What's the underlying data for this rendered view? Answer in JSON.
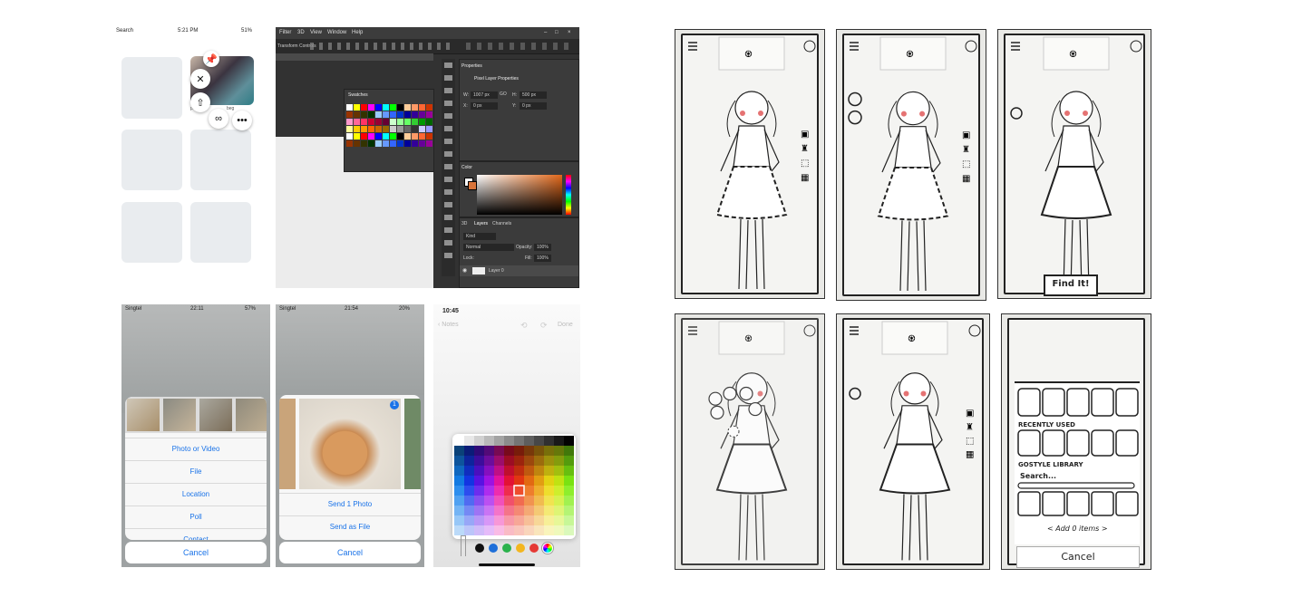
{
  "p1": {
    "status_left": "Search",
    "status_time": "5:21 PM",
    "status_battery": "51%",
    "pin_snippet": "pi",
    "pin_snippet2": "beg"
  },
  "p2": {
    "menu": [
      "Filter",
      "3D",
      "View",
      "Window",
      "Help"
    ],
    "option": "Transform Controls",
    "properties_tab": "Properties",
    "pixel_layer": "Pixel Layer Properties",
    "w_label": "W:",
    "w_value": "1007 px",
    "h_label": "H:",
    "h_value": "500 px",
    "go_label": "GO",
    "x_label": "X:",
    "x_value": "0 px",
    "y_label": "Y:",
    "y_value": "0 px",
    "swatches_tab": "Swatches",
    "color_tab": "Color",
    "layers_tabs": [
      "3D",
      "Layers",
      "Channels"
    ],
    "kind": "Kind",
    "blend": "Normal",
    "opacity_label": "Opacity:",
    "opacity_value": "100%",
    "lock_label": "Lock:",
    "fill_label": "Fill:",
    "fill_value": "100%",
    "layer_name": "Layer 0",
    "swatch_colors": [
      "#ffffff",
      "#ffff00",
      "#ff0000",
      "#ff00ff",
      "#0000ff",
      "#00ffff",
      "#00ff00",
      "#000000",
      "#ffcc99",
      "#ff9966",
      "#ff6633",
      "#cc3300",
      "#993300",
      "#663300",
      "#333300",
      "#003300",
      "#99ccff",
      "#6699ff",
      "#3366ff",
      "#0033cc",
      "#000099",
      "#330099",
      "#660099",
      "#990099",
      "#ff99cc",
      "#ff6699",
      "#ff3366",
      "#cc0033",
      "#990033",
      "#660033",
      "#ccffcc",
      "#99ff99",
      "#66ff66",
      "#33cc33",
      "#009900",
      "#006600",
      "#ffff99",
      "#ffcc00",
      "#ff9900",
      "#ff6600",
      "#cc6600",
      "#996600",
      "#cccccc",
      "#999999",
      "#666666",
      "#333333",
      "#ccccff",
      "#9999ff"
    ]
  },
  "p3": {
    "carrier": "Singtel",
    "time": "22:11",
    "battery": "57%",
    "options": [
      "Photo or Video",
      "File",
      "Location",
      "Poll",
      "Contact"
    ],
    "cancel": "Cancel"
  },
  "p4": {
    "carrier": "Singtel",
    "time": "21:54",
    "battery": "20%",
    "badge": "1",
    "options": [
      "Send 1 Photo",
      "Send as File"
    ],
    "cancel": "Cancel"
  },
  "p5": {
    "time": "10:45",
    "back": "Notes",
    "done": "Done",
    "pen_colors": [
      "#111111",
      "#1e6fd9",
      "#2bb24c",
      "#f3b61f",
      "#e53935"
    ]
  },
  "sketch": {
    "find_button": "Find It!",
    "recently_used": "RECENTLY USED",
    "library": "GOSTYLE LIBRARY",
    "search": "Search...",
    "add_items": "< Add 0 items >",
    "cancel": "Cancel"
  }
}
